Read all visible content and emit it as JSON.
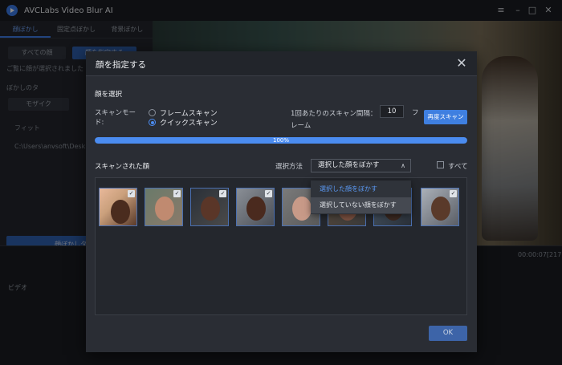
{
  "app": {
    "title": "AVCLabs Video Blur AI"
  },
  "window_controls": {
    "menu": "≡",
    "minimize": "–",
    "maximize": "□",
    "close": "✕"
  },
  "background": {
    "tabs": [
      "顔ぼかし",
      "固定点ぼかし",
      "背景ぼかし"
    ],
    "all_faces_btn": "すべての顔",
    "selected_btn": "顔を指定する",
    "notice": "ご覧に顔が選択されました",
    "blur_type_label": "ぼかしのタ",
    "mosaic_btn": "モザイク",
    "fit_label": "フィット",
    "path": "C:\\Users\\anvsoft\\Desk",
    "add_task": "顔ぼかしタスク",
    "timecode": "00:00:07[217]",
    "timeline_label": "ビデオ"
  },
  "dialog": {
    "title": "顔を指定する",
    "section_select": "顔を選択",
    "scan_mode_label": "スキャンモード:",
    "scan_mode_line1": "スキャンモー",
    "scan_mode_line2": "ド:",
    "frame_scan": "フレームスキャン",
    "quick_scan": "クイックスキャン",
    "interval_label": "1回あたりのスキャン間隔：",
    "interval_value": "10",
    "interval_unit_1": "フ",
    "interval_unit_2": "レーム",
    "rescan_button": "再度スキャン",
    "progress_percent": 100,
    "progress_text": "100%",
    "scanned_faces_label": "スキャンされた顔",
    "method_label": "選択方法",
    "method_selected": "選択した顔をぼかす",
    "method_options": [
      "選択した顔をぼかす",
      "選択していない顔をぼかす"
    ],
    "all_label": "すべて",
    "ok_button": "OK"
  },
  "colors": {
    "accent": "#4b8cf0",
    "dialog_bg": "#2a2d34"
  }
}
